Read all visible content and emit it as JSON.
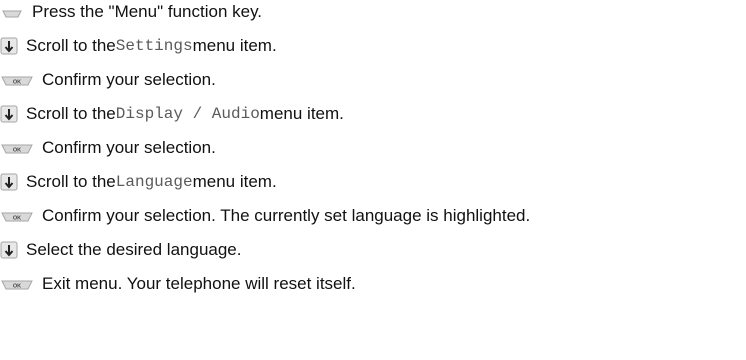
{
  "steps": [
    {
      "icon": "menu-key-icon",
      "text_before": "Press the \"Menu\" function key.",
      "mono": "",
      "text_after": ""
    },
    {
      "icon": "scroll-down-icon",
      "text_before": "Scroll to the ",
      "mono": "Settings",
      "text_after": " menu item."
    },
    {
      "icon": "ok-key-icon",
      "text_before": "Confirm your selection.",
      "mono": "",
      "text_after": ""
    },
    {
      "icon": "scroll-down-icon",
      "text_before": "Scroll to the ",
      "mono": "Display / Audio",
      "text_after": " menu item."
    },
    {
      "icon": "ok-key-icon",
      "text_before": "Confirm your selection.",
      "mono": "",
      "text_after": ""
    },
    {
      "icon": "scroll-down-icon",
      "text_before": "Scroll to the ",
      "mono": "Language",
      "text_after": " menu item."
    },
    {
      "icon": "ok-key-icon",
      "text_before": "Confirm your selection. The currently set language is highlighted.",
      "mono": "",
      "text_after": ""
    },
    {
      "icon": "scroll-down-icon",
      "text_before": "Select the desired language.",
      "mono": "",
      "text_after": ""
    },
    {
      "icon": "ok-key-icon",
      "text_before": "Exit menu. Your telephone will reset itself.",
      "mono": "",
      "text_after": ""
    }
  ],
  "key_labels": {
    "ok": "OK"
  },
  "colors": {
    "key_fill": "#d9d9d9",
    "key_edge": "#a6a6a6",
    "arrow_key_fill": "#e8e8e8",
    "arrow": "#222222"
  }
}
